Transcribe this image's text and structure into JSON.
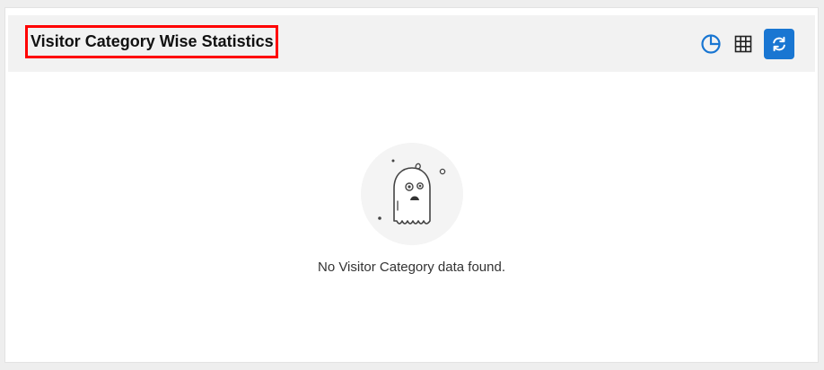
{
  "panel": {
    "title": "Visitor Category Wise Statistics",
    "actions": [
      {
        "name": "pie-chart-view",
        "icon": "pie-chart-icon"
      },
      {
        "name": "table-view",
        "icon": "grid-icon"
      },
      {
        "name": "refresh",
        "icon": "refresh-icon"
      }
    ],
    "accent_color": "#1976d2",
    "highlight_color": "#ff0000"
  },
  "empty_state": {
    "icon": "ghost-icon",
    "message": "No Visitor Category data found."
  }
}
